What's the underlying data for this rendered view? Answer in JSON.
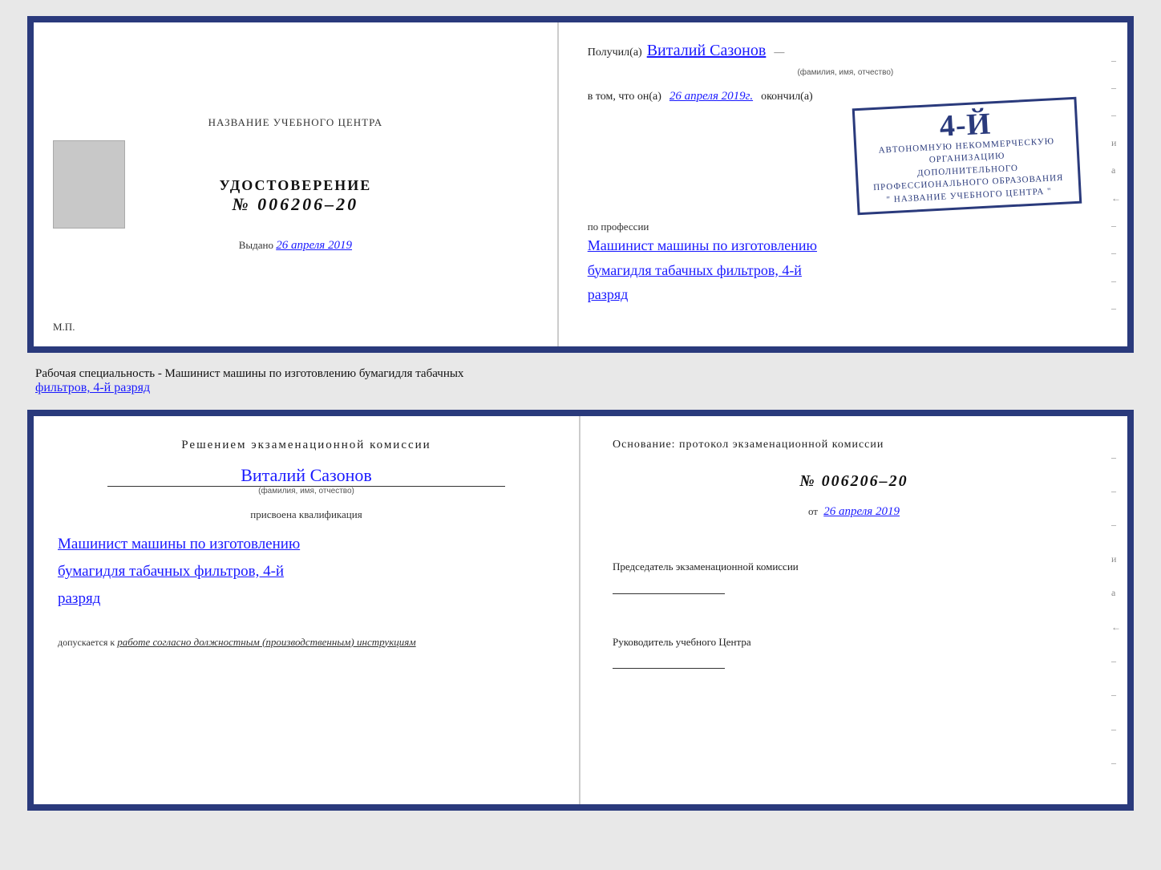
{
  "top_cert": {
    "left": {
      "school_name_label": "НАЗВАНИЕ УЧЕБНОГО ЦЕНТРА",
      "udostoverenie": "УДОСТОВЕРЕНИЕ",
      "number": "№ 006206–20",
      "vydano_prefix": "Выдано",
      "vydano_date": "26 апреля 2019",
      "mp": "М.П."
    },
    "right": {
      "poluchil_prefix": "Получил(а)",
      "recipient_name": "Виталий Сазонов",
      "fio_sub": "(фамилия, имя, отчество)",
      "vtom_prefix": "в том, что он(а)",
      "vtom_date": "26 апреля 2019г.",
      "okonchil": "окончил(а)",
      "stamp_line1": "4-й",
      "stamp_line2": "АВТОНОМНУЮ НЕКОММЕРЧЕСКУЮ ОРГАНИЗАЦИЮ",
      "stamp_line3": "ДОПОЛНИТЕЛЬНОГО ПРОФЕССИОНАЛЬНОГО ОБРАЗОВАНИЯ",
      "stamp_line4": "\" НАЗВАНИЕ УЧЕБНОГО ЦЕНТРА \"",
      "po_professii": "по профессии",
      "profession_line1": "Машинист машины по изготовлению",
      "profession_line2": "бумагидля табачных фильтров, 4-й",
      "profession_line3": "разряд"
    }
  },
  "middle": {
    "text1": "Рабочая специальность - Машинист машины по изготовлению бумагидля табачных",
    "text2": "фильтров, 4-й разряд"
  },
  "bottom_cert": {
    "left": {
      "decision_title": "Решением экзаменационной комиссии",
      "name": "Виталий Сазонов",
      "fio_sub": "(фамилия, имя, отчество)",
      "prisvoena": "присвоена квалификация",
      "qual_line1": "Машинист машины по изготовлению",
      "qual_line2": "бумагидля табачных фильтров, 4-й",
      "qual_line3": "разряд",
      "dopuskaetsya_prefix": "допускается к",
      "dopuskaetsya_italic": "работе согласно должностным (производственным) инструкциям"
    },
    "right": {
      "osnov_label": "Основание: протокол экзаменационной комиссии",
      "number": "№ 006206–20",
      "ot_prefix": "от",
      "ot_date": "26 апреля 2019",
      "predsedatel_label": "Председатель экзаменационной комиссии",
      "rukovod_label": "Руководитель учебного Центра"
    }
  },
  "dashes": [
    "-",
    "–",
    "и",
    "а",
    "←",
    "–",
    "–",
    "–",
    "–"
  ]
}
